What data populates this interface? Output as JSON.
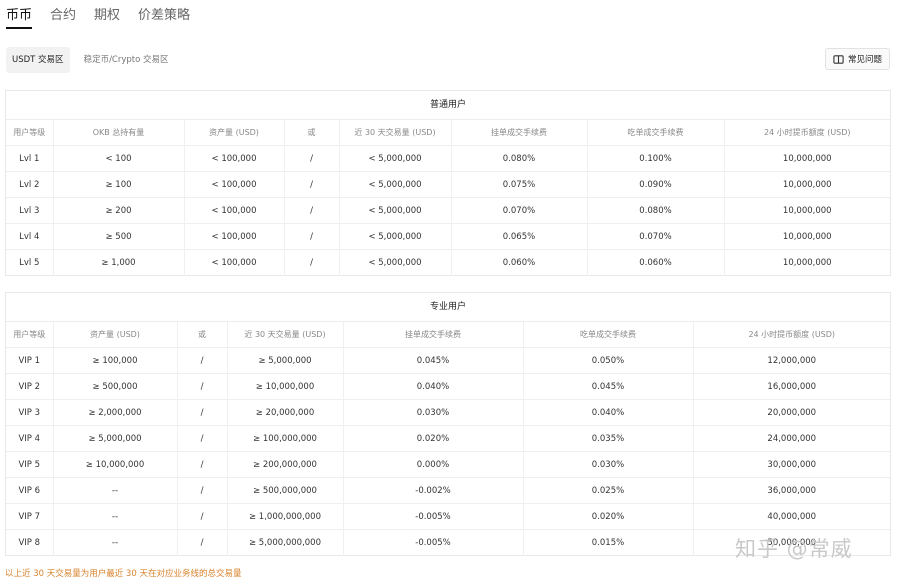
{
  "tabs": [
    "币币",
    "合约",
    "期权",
    "价差策略"
  ],
  "subtabs": [
    "USDT 交易区",
    "稳定币/Crypto 交易区"
  ],
  "faq_label": "常见问题",
  "regular": {
    "title": "普通用户",
    "headers": [
      "用户等级",
      "OKB 总持有量",
      "资产量 (USD)",
      "或",
      "近 30 天交易量 (USD)",
      "挂单成交手续费",
      "吃单成交手续费",
      "24 小时提币额度 (USD)"
    ],
    "rows": [
      [
        "Lvl 1",
        "< 100",
        "< 100,000",
        "/",
        "< 5,000,000",
        "0.080%",
        "0.100%",
        "10,000,000"
      ],
      [
        "Lvl 2",
        "≥ 100",
        "< 100,000",
        "/",
        "< 5,000,000",
        "0.075%",
        "0.090%",
        "10,000,000"
      ],
      [
        "Lvl 3",
        "≥ 200",
        "< 100,000",
        "/",
        "< 5,000,000",
        "0.070%",
        "0.080%",
        "10,000,000"
      ],
      [
        "Lvl 4",
        "≥ 500",
        "< 100,000",
        "/",
        "< 5,000,000",
        "0.065%",
        "0.070%",
        "10,000,000"
      ],
      [
        "Lvl 5",
        "≥ 1,000",
        "< 100,000",
        "/",
        "< 5,000,000",
        "0.060%",
        "0.060%",
        "10,000,000"
      ]
    ]
  },
  "pro": {
    "title": "专业用户",
    "headers": [
      "用户等级",
      "资产量 (USD)",
      "或",
      "近 30 天交易量 (USD)",
      "挂单成交手续费",
      "吃单成交手续费",
      "24 小时提币额度 (USD)"
    ],
    "rows": [
      [
        "VIP 1",
        "≥ 100,000",
        "/",
        "≥ 5,000,000",
        "0.045%",
        "0.050%",
        "12,000,000"
      ],
      [
        "VIP 2",
        "≥ 500,000",
        "/",
        "≥ 10,000,000",
        "0.040%",
        "0.045%",
        "16,000,000"
      ],
      [
        "VIP 3",
        "≥ 2,000,000",
        "/",
        "≥ 20,000,000",
        "0.030%",
        "0.040%",
        "20,000,000"
      ],
      [
        "VIP 4",
        "≥ 5,000,000",
        "/",
        "≥ 100,000,000",
        "0.020%",
        "0.035%",
        "24,000,000"
      ],
      [
        "VIP 5",
        "≥ 10,000,000",
        "/",
        "≥ 200,000,000",
        "0.000%",
        "0.030%",
        "30,000,000"
      ],
      [
        "VIP 6",
        "--",
        "/",
        "≥ 500,000,000",
        "-0.002%",
        "0.025%",
        "36,000,000"
      ],
      [
        "VIP 7",
        "--",
        "/",
        "≥ 1,000,000,000",
        "-0.005%",
        "0.020%",
        "40,000,000"
      ],
      [
        "VIP 8",
        "--",
        "/",
        "≥ 5,000,000,000",
        "-0.005%",
        "0.015%",
        "50,000,000"
      ]
    ]
  },
  "note": "以上近 30 天交易量为用户最近 30 天在对应业务线的总交易量",
  "watermark": "知乎 @常威"
}
